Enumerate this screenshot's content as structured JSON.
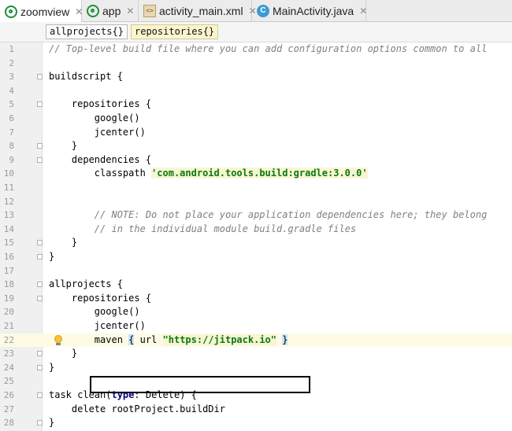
{
  "tabs": [
    {
      "label": "zoomview",
      "icon": "gradle-icon",
      "active": true,
      "closable": true
    },
    {
      "label": "app",
      "icon": "gradle-icon",
      "active": false,
      "closable": true
    },
    {
      "label": "activity_main.xml",
      "icon": "xml-file-icon",
      "active": false,
      "closable": true
    },
    {
      "label": "MainActivity.java",
      "icon": "java-class-icon",
      "active": false,
      "closable": true
    }
  ],
  "tab_close_glyph": "✕",
  "breadcrumbs": [
    {
      "label": "allprojects{}",
      "selected": false
    },
    {
      "label": "repositories{}",
      "selected": true
    }
  ],
  "editor": {
    "current_line": 22,
    "highlight_box_line": 22,
    "lines": [
      {
        "n": "1",
        "parts": [
          {
            "t": "// Top-level build file where you can add configuration options common to all",
            "c": "cm"
          }
        ]
      },
      {
        "n": "2",
        "parts": []
      },
      {
        "n": "3",
        "parts": [
          {
            "t": "buildscript {",
            "c": ""
          }
        ]
      },
      {
        "n": "4",
        "parts": []
      },
      {
        "n": "5",
        "parts": [
          {
            "t": "    repositories {",
            "c": ""
          }
        ]
      },
      {
        "n": "6",
        "parts": [
          {
            "t": "        google()",
            "c": ""
          }
        ]
      },
      {
        "n": "7",
        "parts": [
          {
            "t": "        jcenter()",
            "c": ""
          }
        ]
      },
      {
        "n": "8",
        "parts": [
          {
            "t": "    }",
            "c": ""
          }
        ]
      },
      {
        "n": "9",
        "parts": [
          {
            "t": "    dependencies {",
            "c": ""
          }
        ]
      },
      {
        "n": "10",
        "parts": [
          {
            "t": "        classpath ",
            "c": ""
          },
          {
            "t": "'com.android.tools.build:gradle:3.0.0'",
            "c": "str"
          }
        ]
      },
      {
        "n": "11",
        "parts": []
      },
      {
        "n": "12",
        "parts": []
      },
      {
        "n": "13",
        "parts": [
          {
            "t": "        // NOTE: Do not place your application dependencies here; they belong",
            "c": "cm"
          }
        ]
      },
      {
        "n": "14",
        "parts": [
          {
            "t": "        // in the individual module build.gradle files",
            "c": "cm"
          }
        ]
      },
      {
        "n": "15",
        "parts": [
          {
            "t": "    }",
            "c": ""
          }
        ]
      },
      {
        "n": "16",
        "parts": [
          {
            "t": "}",
            "c": ""
          }
        ]
      },
      {
        "n": "17",
        "parts": []
      },
      {
        "n": "18",
        "parts": [
          {
            "t": "allprojects {",
            "c": ""
          }
        ]
      },
      {
        "n": "19",
        "parts": [
          {
            "t": "    repositories {",
            "c": ""
          }
        ]
      },
      {
        "n": "20",
        "parts": [
          {
            "t": "        google()",
            "c": ""
          }
        ]
      },
      {
        "n": "21",
        "parts": [
          {
            "t": "        jcenter()",
            "c": ""
          }
        ]
      },
      {
        "n": "22",
        "parts": [
          {
            "t": "        maven ",
            "c": ""
          },
          {
            "t": "{",
            "c": "hlbrace"
          },
          {
            "t": " url ",
            "c": ""
          },
          {
            "t": "\"https://jitpack.io\"",
            "c": "str"
          },
          {
            "t": " ",
            "c": ""
          },
          {
            "t": "}",
            "c": "hlbrace"
          }
        ]
      },
      {
        "n": "23",
        "parts": [
          {
            "t": "    }",
            "c": ""
          }
        ]
      },
      {
        "n": "24",
        "parts": [
          {
            "t": "}",
            "c": ""
          }
        ]
      },
      {
        "n": "25",
        "parts": []
      },
      {
        "n": "26",
        "parts": [
          {
            "t": "task clean(",
            "c": ""
          },
          {
            "t": "type",
            "c": "kw"
          },
          {
            "t": ": Delete) {",
            "c": ""
          }
        ]
      },
      {
        "n": "27",
        "parts": [
          {
            "t": "    delete rootProject.buildDir",
            "c": ""
          }
        ]
      },
      {
        "n": "28",
        "parts": [
          {
            "t": "}",
            "c": ""
          }
        ]
      }
    ]
  },
  "colors": {
    "comment": "#808080",
    "string": "#0a7a0a",
    "keyword": "#000080",
    "current_line_bg": "#fefbe4",
    "breadcrumb_selected_bg": "#fbf5cf"
  }
}
